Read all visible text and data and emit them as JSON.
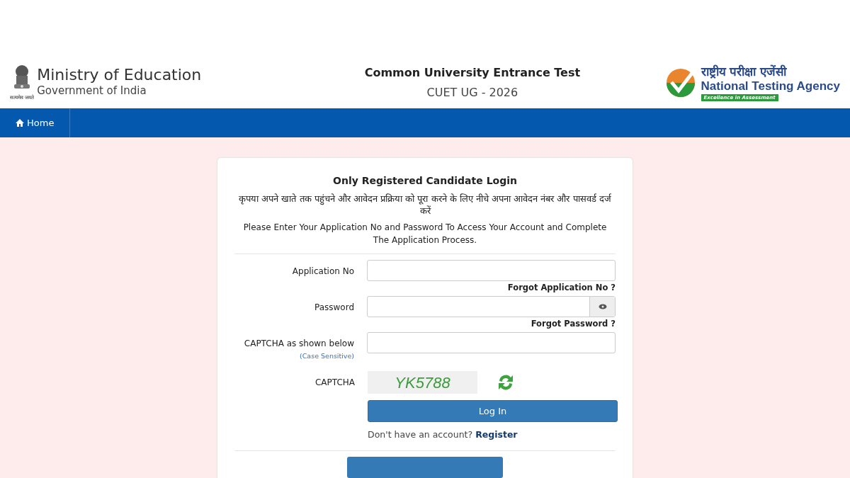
{
  "header": {
    "ministry_title": "Ministry of Education",
    "ministry_subtitle": "Government of India",
    "emblem_motto": "सत्यमेव जयते",
    "exam_title": "Common University Entrance Test",
    "exam_subtitle": "CUET UG - 2026",
    "agency_hindi": "राष्ट्रीय परीक्षा एजेंसी",
    "agency_name": "National Testing Agency",
    "agency_tagline": "Excellence in Assessment"
  },
  "nav": {
    "items": [
      {
        "label": "Home",
        "selected": false
      }
    ]
  },
  "login": {
    "title": "Only Registered Candidate Login",
    "hindi_instructions": "कृपया अपने खाते तक पहुंचने और आवेदन प्रक्रिया को पूरा करने के लिए नीचे अपना आवेदन नंबर और पासवर्ड दर्ज करें",
    "instructions": "Please Enter Your Application No and Password To Access Your Account and Complete The Application Process.",
    "fields": [
      {
        "kind": "text",
        "label": "Application No",
        "link": "Forgot Application No ?"
      },
      {
        "kind": "password",
        "label": "Password",
        "link": "Forgot Password ?"
      },
      {
        "kind": "captcha_input",
        "label": "CAPTCHA as shown below",
        "note": "(Case Sensitive)"
      }
    ],
    "captcha_label": "CAPTCHA",
    "captcha_text": "YK5788",
    "submit": "Log In",
    "register_prompt": "Don't have an account?",
    "register_link": "Register"
  }
}
